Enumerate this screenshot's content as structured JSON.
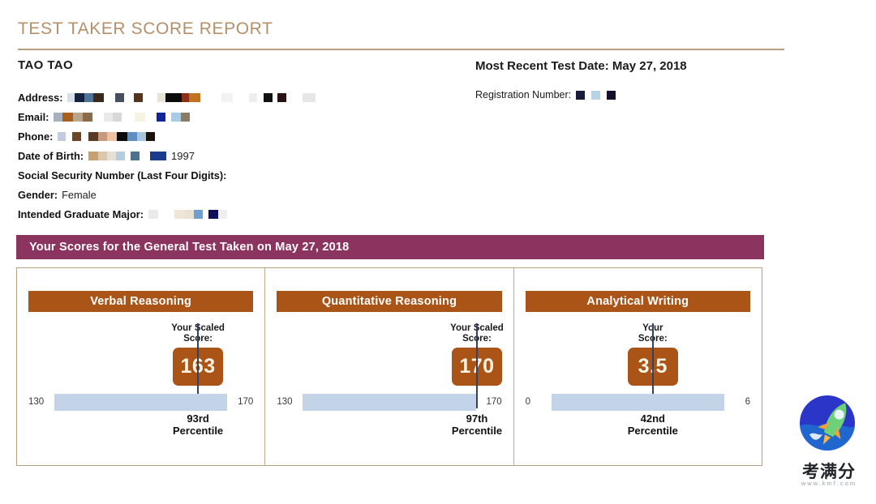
{
  "report": {
    "title": "TEST TAKER SCORE REPORT",
    "taker_name": "TAO TAO",
    "most_recent_test_date": "Most Recent Test Date: May 27, 2018",
    "registration_number_label": "Registration Number:"
  },
  "info": {
    "address_label": "Address:",
    "email_label": "Email:",
    "phone_label": "Phone:",
    "dob_label": "Date of Birth:",
    "dob_year": "1997",
    "ssn_label": "Social Security Number (Last Four Digits):",
    "gender_label": "Gender:",
    "gender_value": "Female",
    "major_label": "Intended Graduate Major:"
  },
  "banner": {
    "text": "Your Scores for the General Test Taken on May 27, 2018"
  },
  "chart_data": {
    "type": "bar",
    "title": "Your Scores for the General Test Taken on May 27, 2018",
    "xlabel": "",
    "ylabel": "",
    "grid": false,
    "legend": "none",
    "categories": [
      "Verbal Reasoning",
      "Quantitative Reasoning",
      "Analytical Writing"
    ],
    "series": [
      {
        "name": "Scaled Score",
        "values": [
          163,
          170,
          3.5
        ]
      },
      {
        "name": "Percentile",
        "values": [
          93,
          97,
          42
        ]
      }
    ],
    "sections": [
      {
        "name": "Verbal Reasoning",
        "score_caption": "Your Scaled\nScore:",
        "score": "163",
        "score_value": 163,
        "scale_min": "130",
        "scale_max": "170",
        "scale_min_value": 130,
        "scale_max_value": 170,
        "marker_percent": 82.5,
        "percentile": "93rd\nPercentile",
        "percentile_value": 93
      },
      {
        "name": "Quantitative Reasoning",
        "score_caption": "Your Scaled\nScore:",
        "score": "170",
        "score_value": 170,
        "scale_min": "130",
        "scale_max": "170",
        "scale_min_value": 130,
        "scale_max_value": 170,
        "marker_percent": 100,
        "percentile": "97th\nPercentile",
        "percentile_value": 97
      },
      {
        "name": "Analytical Writing",
        "score_caption": "Your\nScore:",
        "score": "3.5",
        "score_value": 3.5,
        "scale_min": "0",
        "scale_max": "6",
        "scale_min_value": 0,
        "scale_max_value": 6,
        "marker_percent": 58.3,
        "percentile": "42nd\nPercentile",
        "percentile_value": 42
      }
    ]
  },
  "watermark": {
    "brand": "考满分",
    "url": "www.kmf.com"
  },
  "colors": {
    "title_tan": "#b4906a",
    "rule_tan": "#b9a083",
    "banner_maroon": "#8c3460",
    "section_orange": "#ab5418",
    "scale_blue": "#c3d4e8",
    "marker_line": "#35425c",
    "score_text_cream": "#fdf3e2"
  },
  "redactions": {
    "address": [
      [
        "#d7e0ea",
        9
      ],
      [
        "#15233f",
        12
      ],
      [
        "#4f7397",
        11
      ],
      [
        "#3b2a1c",
        13
      ],
      [
        "#ffffff",
        14
      ],
      [
        "#454f5e",
        11
      ],
      [
        "#ffffff",
        12
      ],
      [
        "#55331c",
        11
      ],
      [
        "#ffffff",
        18
      ],
      [
        "#e8e2d6",
        10
      ],
      [
        "#0c0c0c",
        20
      ],
      [
        "#8d2f17",
        9
      ],
      [
        "#c0721f",
        14
      ],
      [
        "#ffffff",
        26
      ],
      [
        "#f2f2f2",
        14
      ],
      [
        "#ffffff",
        20
      ],
      [
        "#eeeeee",
        10
      ],
      [
        "#ffffff",
        8
      ],
      [
        "#111111",
        11
      ],
      [
        "#ffffff",
        6
      ],
      [
        "#2a1313",
        11
      ],
      [
        "#ffffff",
        20
      ],
      [
        "#e6e6e6",
        16
      ]
    ],
    "address_second": [
      [
        "#6b6b6b",
        11
      ]
    ],
    "email": [
      [
        "#a9b0bd",
        11
      ],
      [
        "#a8601f",
        13
      ],
      [
        "#b9a58c",
        12
      ],
      [
        "#8c6a48",
        12
      ],
      [
        "#ffffff",
        14
      ],
      [
        "#e9e9e9",
        11
      ],
      [
        "#d8d8d8",
        11
      ],
      [
        "#ffffff",
        16
      ],
      [
        "#f6f2e4",
        13
      ],
      [
        "#ffffff",
        14
      ],
      [
        "#10259a",
        11
      ],
      [
        "#ffffff",
        7
      ],
      [
        "#a8cbe8",
        12
      ],
      [
        "#8b7b63",
        11
      ]
    ],
    "phone": [
      [
        "#c2cbdf",
        10
      ],
      [
        "#ffffff",
        8
      ],
      [
        "#6b4524",
        11
      ],
      [
        "#ffffff",
        9
      ],
      [
        "#5a3a22",
        12
      ],
      [
        "#c79a7e",
        11
      ],
      [
        "#f0c0a6",
        12
      ],
      [
        "#0a0a0a",
        13
      ],
      [
        "#5d8fc4",
        12
      ],
      [
        "#a9c6e0",
        11
      ],
      [
        "#1a1208",
        11
      ]
    ],
    "dob": [
      [
        "#c9a072",
        12
      ],
      [
        "#d9c7ae",
        11
      ],
      [
        "#e6e0d4",
        11
      ],
      [
        "#b6cde0",
        11
      ],
      [
        "#ffffff",
        7
      ],
      [
        "#4c7290",
        11
      ],
      [
        "#ffffff",
        13
      ],
      [
        "#1b3b8f",
        20
      ]
    ],
    "major": [
      [
        "#eaeaea",
        12
      ],
      [
        "#ffffff",
        20
      ],
      [
        "#f0e6d8",
        13
      ],
      [
        "#e8e2d2",
        11
      ],
      [
        "#6f9ed0",
        11
      ],
      [
        "#ffffff",
        7
      ],
      [
        "#0d0f5a",
        12
      ],
      [
        "#eeeeee",
        11
      ]
    ],
    "registration": [
      [
        "#1b1b3a",
        11
      ],
      [
        "#ffffff",
        8
      ],
      [
        "#b6d4e8",
        11
      ],
      [
        "#ffffff",
        8
      ],
      [
        "#11112e",
        11
      ]
    ]
  }
}
